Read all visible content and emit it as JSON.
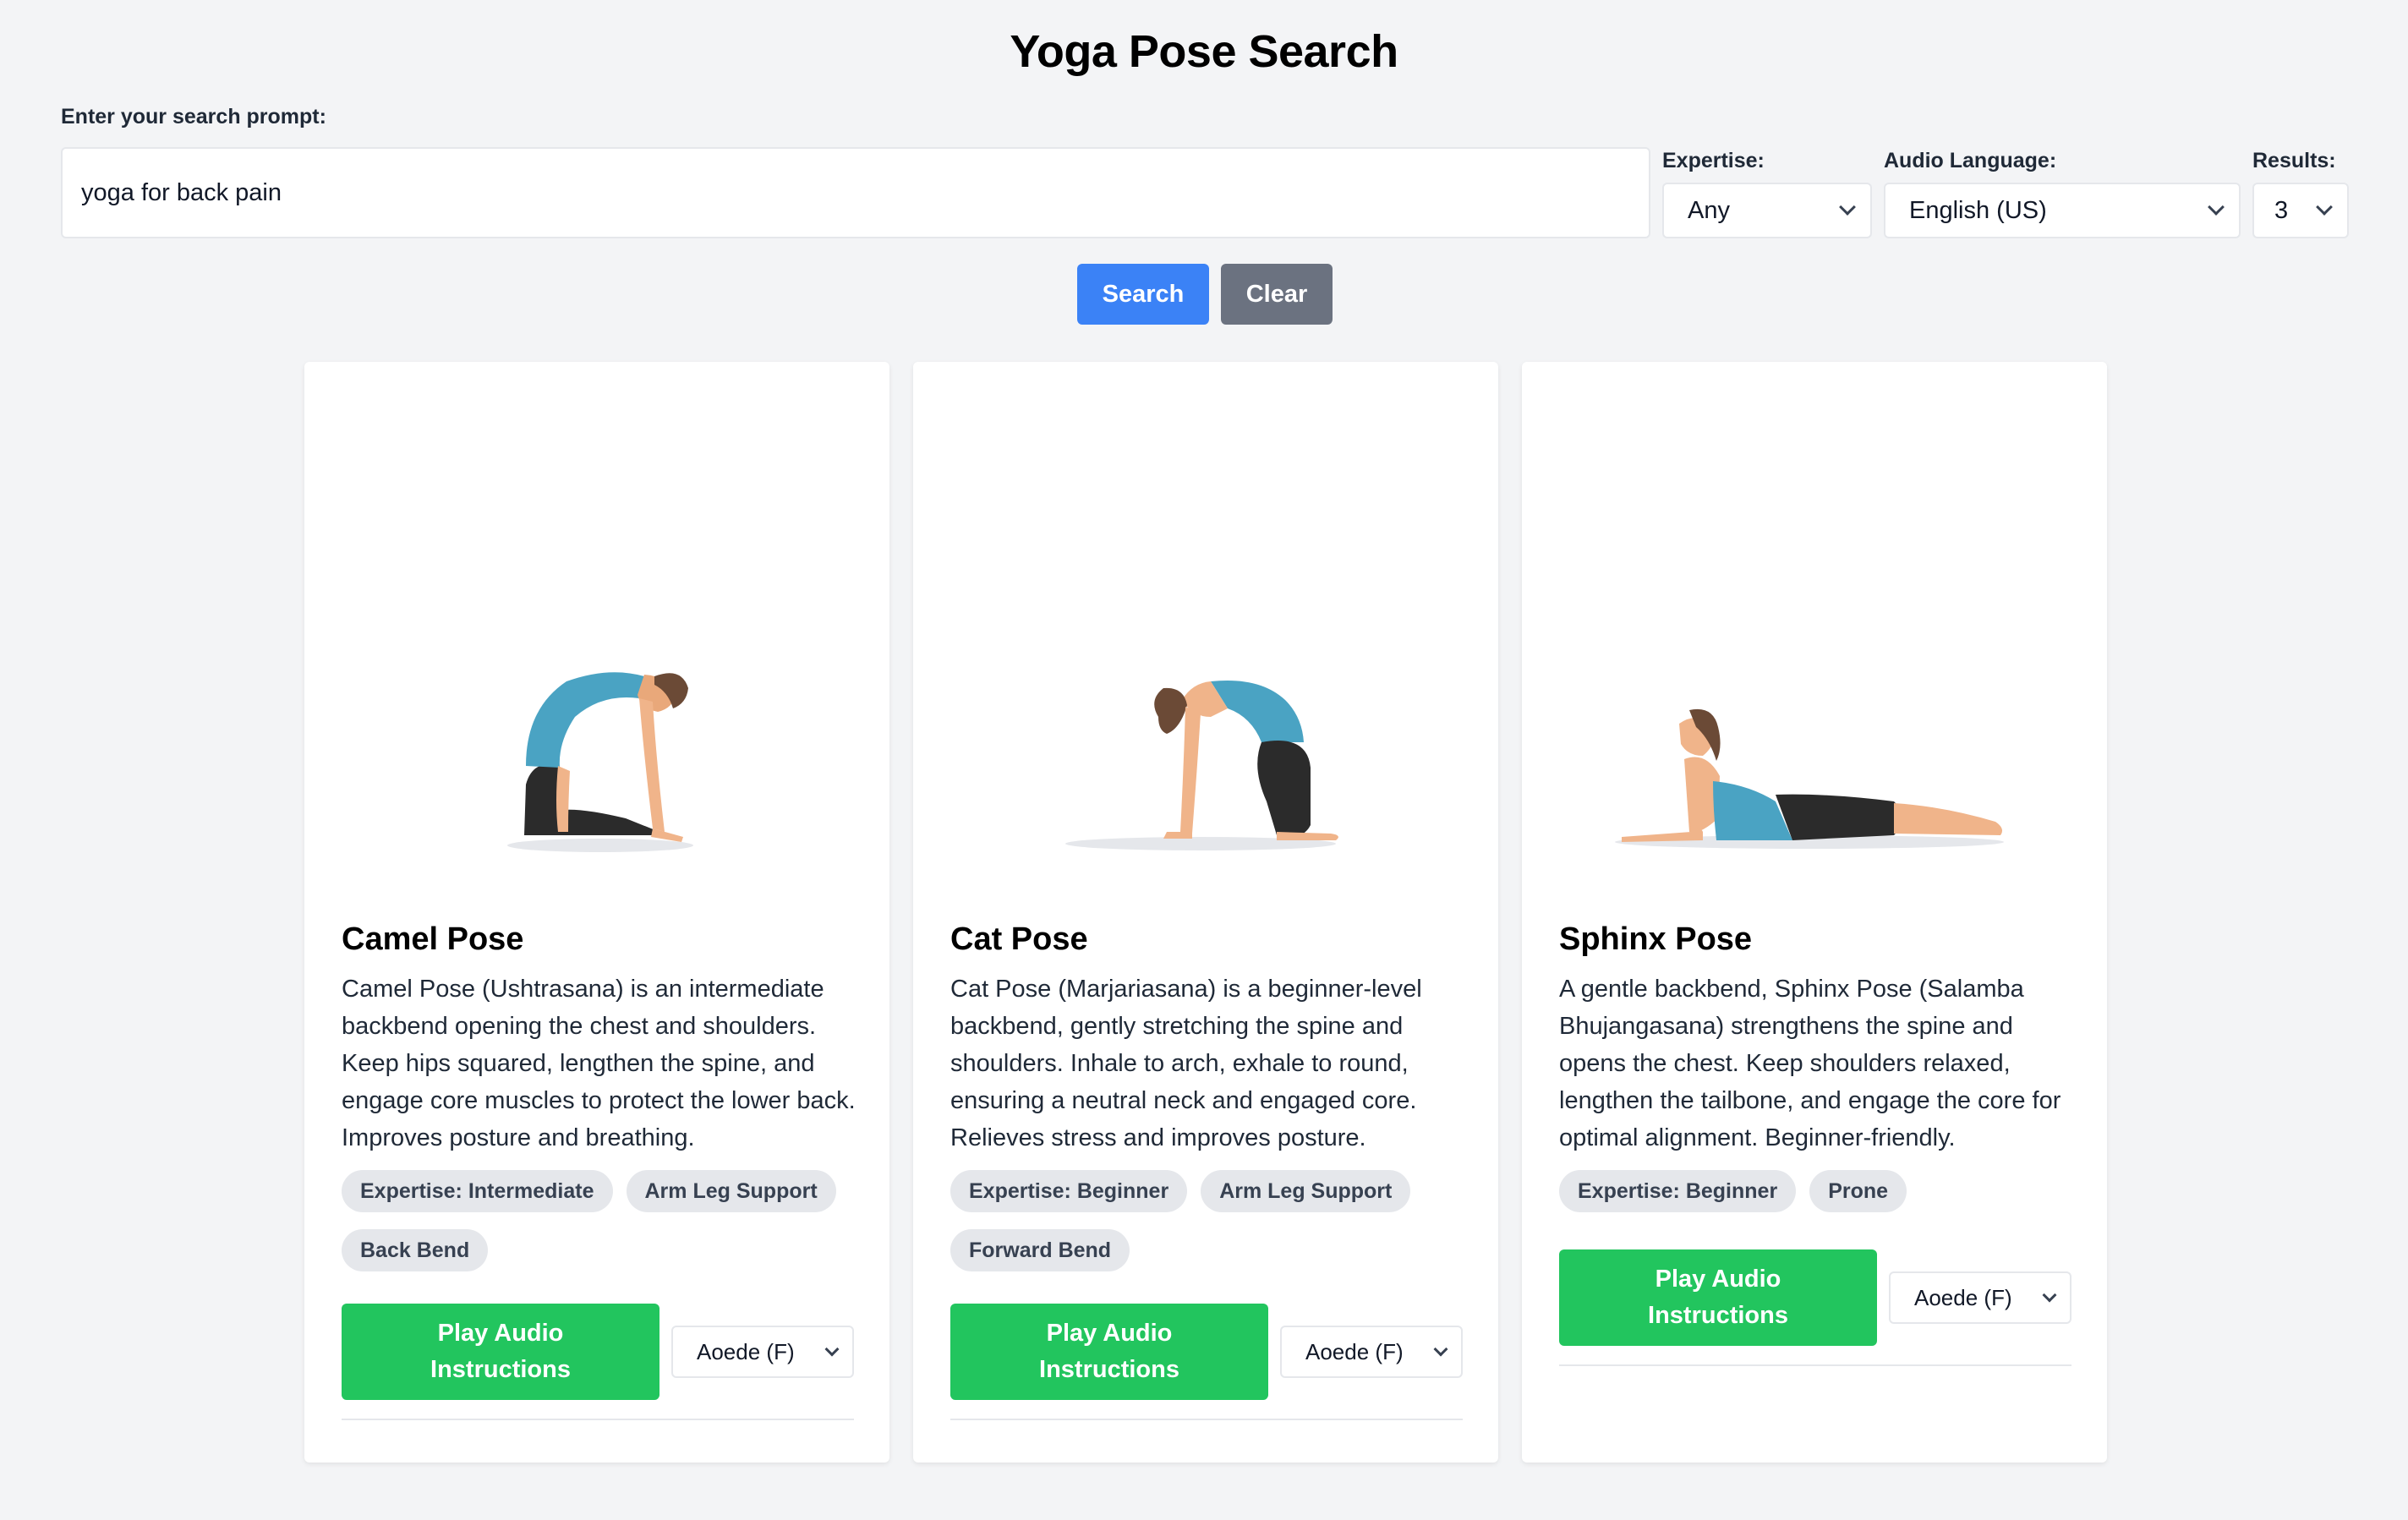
{
  "page_title": "Yoga Pose Search",
  "search": {
    "label": "Enter your search prompt:",
    "value": "yoga for back pain"
  },
  "filters": {
    "expertise": {
      "label": "Expertise:",
      "value": "Any"
    },
    "audio_language": {
      "label": "Audio Language:",
      "value": "English (US)"
    },
    "results": {
      "label": "Results:",
      "value": "3"
    }
  },
  "buttons": {
    "search": "Search",
    "clear": "Clear"
  },
  "colors": {
    "background": "#f3f4f6",
    "search_button": "#3b82f6",
    "clear_button": "#6b7280",
    "play_button": "#22c55e",
    "tag_bg": "#e5e7eb"
  },
  "cards": [
    {
      "title": "Camel Pose",
      "description": "Camel Pose (Ushtrasana) is an intermediate backbend opening the chest and shoulders. Keep hips squared, lengthen the spine, and engage core muscles to protect the lower back. Improves posture and breathing.",
      "tags": [
        "Expertise: Intermediate",
        "Arm Leg Support",
        "Back Bend"
      ],
      "play_label": "Play Audio Instructions",
      "voice": "Aoede (F)",
      "illustration": "camel-pose-illustration"
    },
    {
      "title": "Cat Pose",
      "description": "Cat Pose (Marjariasana) is a beginner-level backbend, gently stretching the spine and shoulders. Inhale to arch, exhale to round, ensuring a neutral neck and engaged core. Relieves stress and improves posture.",
      "tags": [
        "Expertise: Beginner",
        "Arm Leg Support",
        "Forward Bend"
      ],
      "play_label": "Play Audio Instructions",
      "voice": "Aoede (F)",
      "illustration": "cat-pose-illustration"
    },
    {
      "title": "Sphinx Pose",
      "description": "A gentle backbend, Sphinx Pose (Salamba Bhujangasana) strengthens the spine and opens the chest. Keep shoulders relaxed, lengthen the tailbone, and engage the core for optimal alignment. Beginner-friendly.",
      "tags": [
        "Expertise: Beginner",
        "Prone"
      ],
      "play_label": "Play Audio Instructions",
      "voice": "Aoede (F)",
      "illustration": "sphinx-pose-illustration"
    }
  ]
}
